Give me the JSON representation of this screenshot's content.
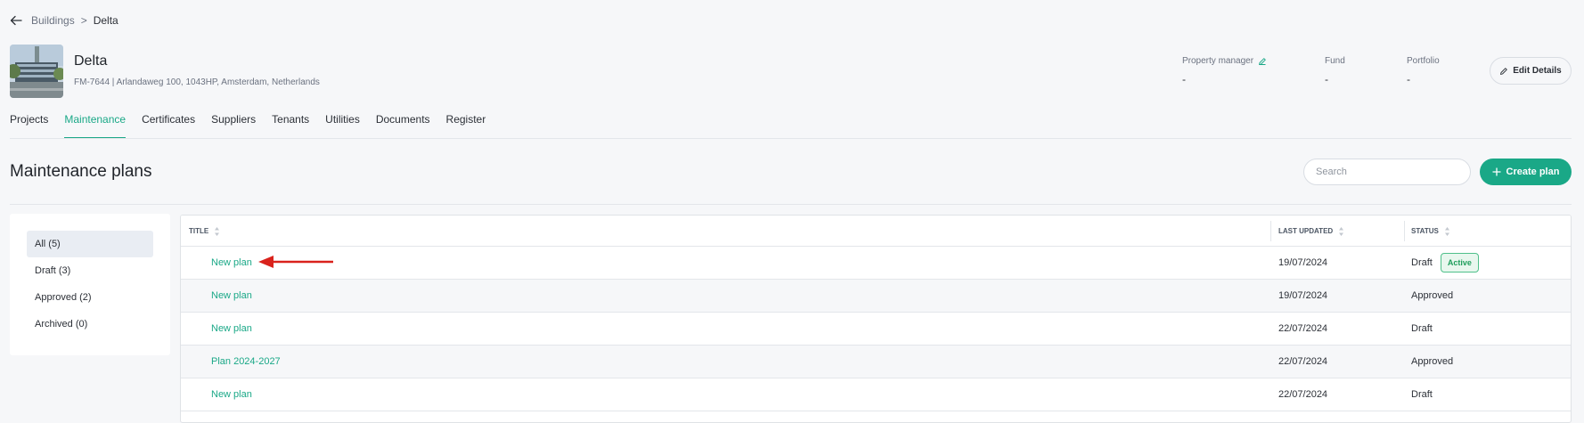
{
  "breadcrumb": {
    "parent": "Buildings",
    "separator": ">",
    "current": "Delta"
  },
  "building": {
    "name": "Delta",
    "address": "FM-7644 | Arlandaweg 100, 1043HP, Amsterdam, Netherlands"
  },
  "meta": [
    {
      "label": "Property manager",
      "value": "-"
    },
    {
      "label": "Fund",
      "value": "-"
    },
    {
      "label": "Portfolio",
      "value": "-"
    }
  ],
  "edit_button": "Edit Details",
  "tabs": [
    {
      "label": "Projects"
    },
    {
      "label": "Maintenance",
      "active": true
    },
    {
      "label": "Certificates"
    },
    {
      "label": "Suppliers"
    },
    {
      "label": "Tenants"
    },
    {
      "label": "Utilities"
    },
    {
      "label": "Documents"
    },
    {
      "label": "Register"
    }
  ],
  "page_title": "Maintenance plans",
  "search": {
    "placeholder": "Search",
    "value": ""
  },
  "create_button": "Create plan",
  "filters": [
    {
      "label": "All (5)",
      "active": true
    },
    {
      "label": "Draft (3)"
    },
    {
      "label": "Approved (2)"
    },
    {
      "label": "Archived (0)"
    }
  ],
  "table": {
    "headers": {
      "title": "TITLE",
      "last_updated": "LAST UPDATED",
      "status": "STATUS"
    },
    "rows": [
      {
        "title": "New plan",
        "last_updated": "19/07/2024",
        "status": "Draft",
        "badge": "Active"
      },
      {
        "title": "New plan",
        "last_updated": "19/07/2024",
        "status": "Approved"
      },
      {
        "title": "New plan",
        "last_updated": "22/07/2024",
        "status": "Draft"
      },
      {
        "title": "Plan 2024-2027",
        "last_updated": "22/07/2024",
        "status": "Approved"
      },
      {
        "title": "New plan",
        "last_updated": "22/07/2024",
        "status": "Draft"
      }
    ]
  },
  "colors": {
    "accent": "#1aa887",
    "badge_border": "#4fc08a",
    "badge_bg": "#e8f7ee",
    "annotation_arrow": "#d9221c"
  },
  "icons": [
    "arrow-left-icon",
    "pencil-icon",
    "plus-icon",
    "sort-icon"
  ]
}
